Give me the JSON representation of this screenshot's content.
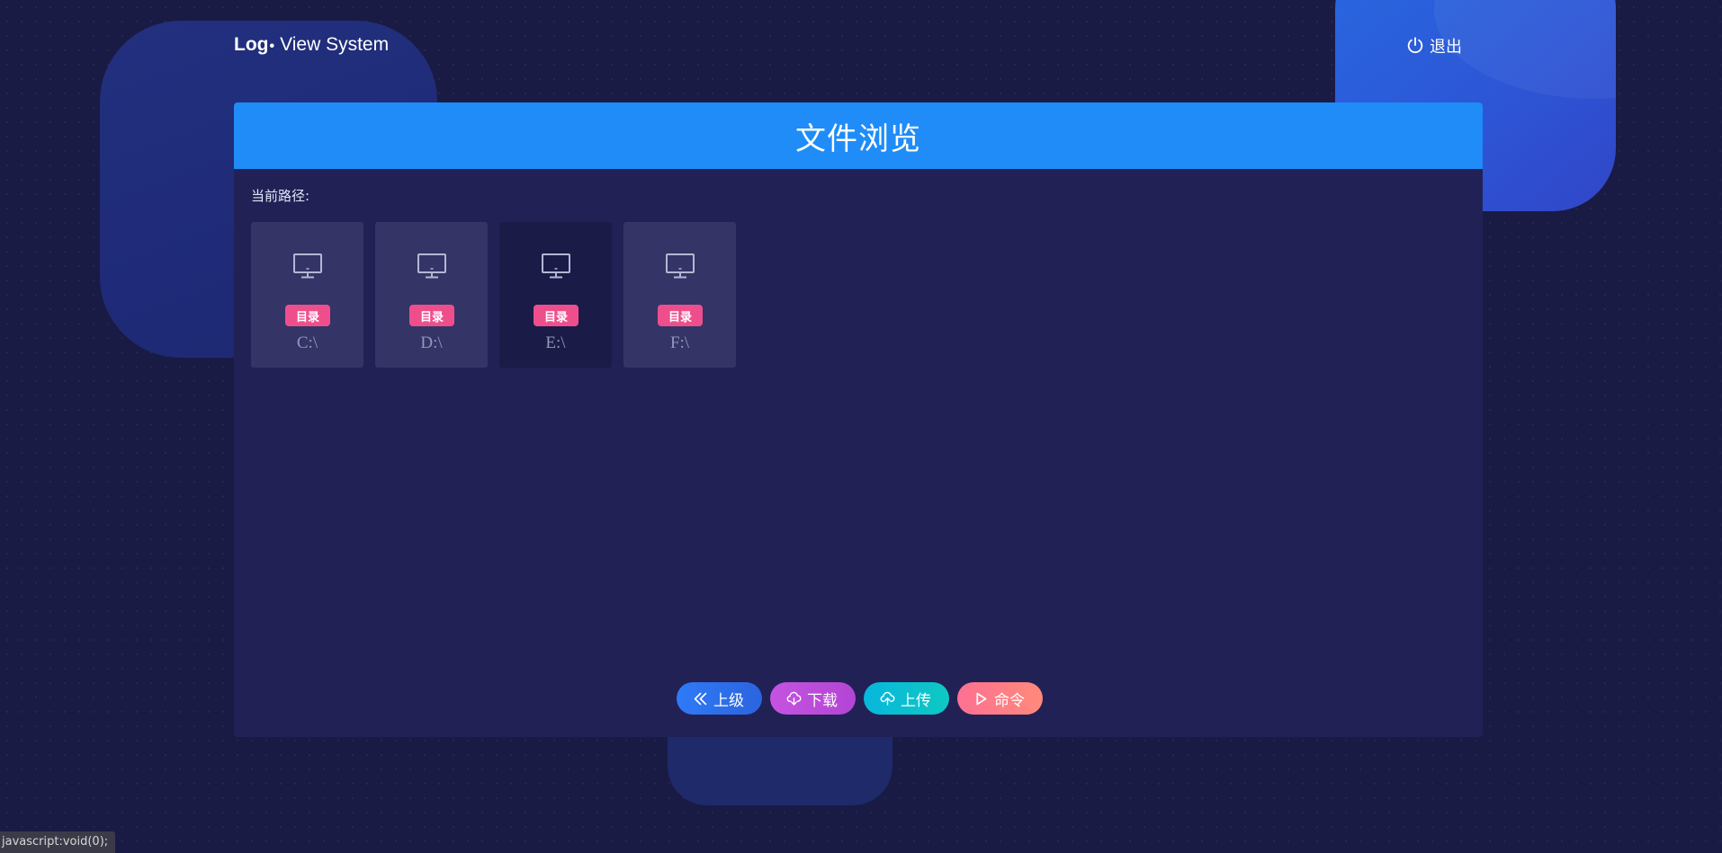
{
  "brand": {
    "bold": "Log",
    "dot": "•",
    "rest": "View System"
  },
  "logout": {
    "label": "退出",
    "icon": "power-icon"
  },
  "panel": {
    "title": "文件浏览",
    "path_label": "当前路径:",
    "tiles": [
      {
        "badge": "目录",
        "name": "C:\\",
        "icon": "monitor-icon"
      },
      {
        "badge": "目录",
        "name": "D:\\",
        "icon": "monitor-icon"
      },
      {
        "badge": "目录",
        "name": "E:\\",
        "icon": "monitor-icon",
        "hovered": true
      },
      {
        "badge": "目录",
        "name": "F:\\",
        "icon": "monitor-icon"
      }
    ]
  },
  "actions": {
    "up": "上级",
    "download": "下载",
    "upload": "上传",
    "command": "命令"
  },
  "statusbar": "javascript:void(0);",
  "colors": {
    "background": "#191b45",
    "header": "#1f8cf8",
    "panel": "#212156",
    "badge": "#ee4f8c",
    "btn_up": "#2f7af7",
    "btn_download": "#c454e0",
    "btn_upload": "#08b7dc",
    "btn_command": "#fd7092"
  }
}
